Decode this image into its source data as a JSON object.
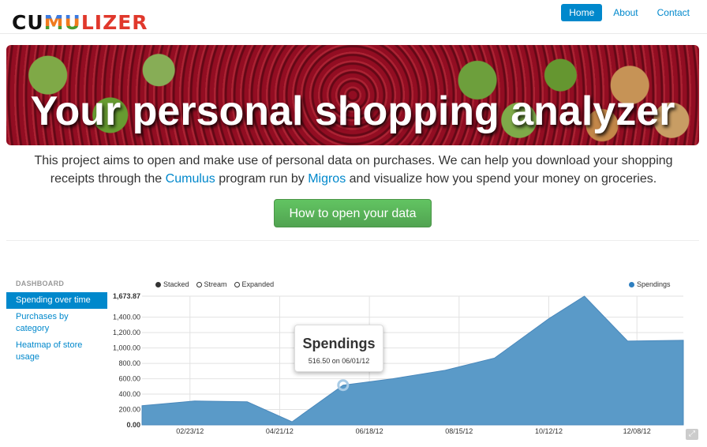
{
  "header": {
    "logo": [
      "CU",
      "MU",
      "LIZER"
    ],
    "nav": [
      {
        "label": "Home",
        "active": true
      },
      {
        "label": "About",
        "active": false
      },
      {
        "label": "Contact",
        "active": false
      }
    ]
  },
  "hero": {
    "title": "Your personal shopping analyzer"
  },
  "intro": {
    "text_1": "This project aims to open and make use of personal data on purchases. We can help you download your shopping receipts through the ",
    "link_cumulus": "Cumulus",
    "text_2": " program run by ",
    "link_migros": "Migros",
    "text_3": " and visualize how you spend your money on groceries."
  },
  "cta": {
    "label": "How to open your data"
  },
  "sidebar": {
    "title": "DASHBOARD",
    "items": [
      {
        "label": "Spending over time",
        "active": true
      },
      {
        "label": "Purchases by category",
        "active": false
      },
      {
        "label": "Heatmap of store usage",
        "active": false
      }
    ]
  },
  "chart_controls": {
    "modes": [
      {
        "label": "Stacked",
        "selected": true
      },
      {
        "label": "Stream",
        "selected": false
      },
      {
        "label": "Expanded",
        "selected": false
      }
    ],
    "legend": "Spendings"
  },
  "tooltip": {
    "title": "Spendings",
    "value": "516.50 on 06/01/12"
  },
  "colors": {
    "accent": "#0088cc",
    "series": "#5a9ac8",
    "cta": "#5bb75b"
  },
  "chart_data": {
    "type": "area",
    "series": [
      {
        "name": "Spendings",
        "points": [
          {
            "x": "2012-01-23",
            "y": 250
          },
          {
            "x": "2012-02-26",
            "y": 310
          },
          {
            "x": "2012-03-31",
            "y": 300
          },
          {
            "x": "2012-04-29",
            "y": 40
          },
          {
            "x": "2012-06-01",
            "y": 516.5
          },
          {
            "x": "2012-07-03",
            "y": 600
          },
          {
            "x": "2012-08-06",
            "y": 710
          },
          {
            "x": "2012-09-07",
            "y": 870
          },
          {
            "x": "2012-10-12",
            "y": 1380
          },
          {
            "x": "2012-11-04",
            "y": 1673.87
          },
          {
            "x": "2012-12-02",
            "y": 1090
          },
          {
            "x": "2013-01-07",
            "y": 1100
          }
        ]
      }
    ],
    "y_ticks": [
      "0.00",
      "200.00",
      "400.00",
      "600.00",
      "800.00",
      "1,000.00",
      "1,200.00",
      "1,400.00",
      "1,673.87"
    ],
    "x_ticks": [
      "02/23/12",
      "04/21/12",
      "06/18/12",
      "08/15/12",
      "10/12/12",
      "12/08/12"
    ],
    "ylim": [
      0,
      1673.87
    ],
    "grid": true,
    "legend": "top-right",
    "highlight_x": "2012-06-01"
  }
}
